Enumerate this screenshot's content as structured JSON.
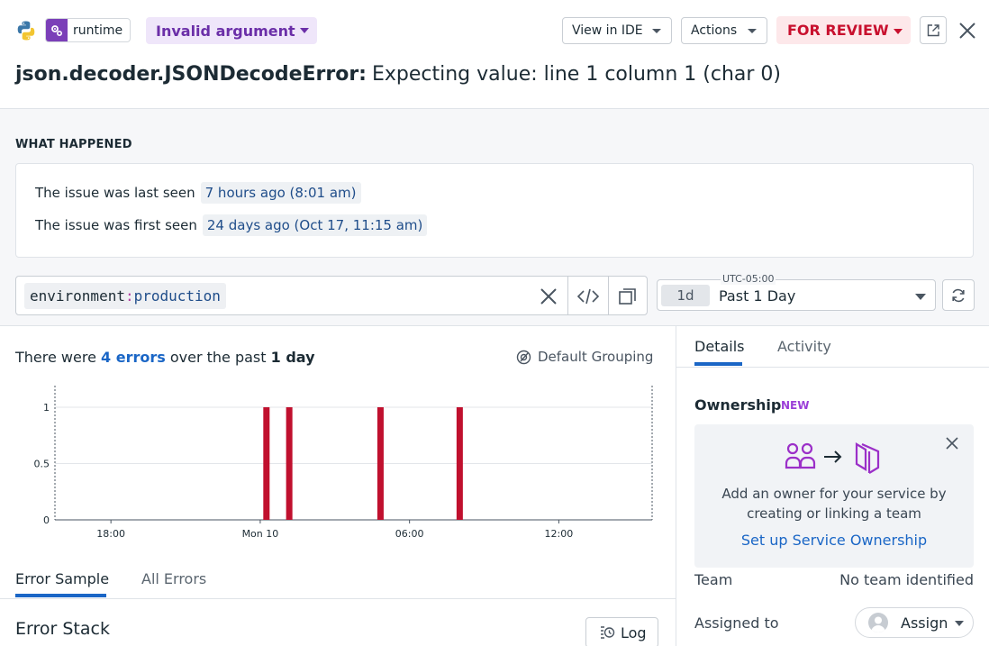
{
  "header": {
    "service_label": "runtime",
    "error_type_label": "Invalid argument",
    "view_in_ide_label": "View in IDE",
    "actions_label": "Actions",
    "status_label": "FOR REVIEW",
    "exception_class": "json.decoder.JSONDecodeError:",
    "exception_message": "Expecting value: line 1 column 1 (char 0)",
    "colors": {
      "status": "#c8102e",
      "type_pill": "#6b2fa8",
      "accent": "#1a66c6"
    }
  },
  "what_happened": {
    "label": "WHAT HAPPENED",
    "last_seen_text": "The issue was last seen",
    "last_seen_value": "7 hours ago (8:01 am)",
    "first_seen_text": "The issue was first seen",
    "first_seen_value": "24 days ago (Oct 17, 11:15 am)"
  },
  "query": {
    "key": "environment",
    "sep": ":",
    "value": "production"
  },
  "time": {
    "timezone": "UTC-05:00",
    "badge": "1d",
    "range_label": "Past 1 Day"
  },
  "summary": {
    "prefix": "There were",
    "count_link": "4 errors",
    "middle": "over the past",
    "period": "1 day",
    "grouping_label": "Default Grouping"
  },
  "chart_data": {
    "type": "bar",
    "x_ticks": [
      "18:00",
      "Mon 10",
      "06:00",
      "12:00"
    ],
    "y_ticks": [
      "0",
      "0.5",
      "1"
    ],
    "ylim": [
      0,
      1
    ],
    "bar_color": "#c0102e",
    "bars": [
      {
        "time": "Mon 10 00:15",
        "value": 1
      },
      {
        "time": "Mon 10 01:10",
        "value": 1
      },
      {
        "time": "Mon 10 04:50",
        "value": 1
      },
      {
        "time": "Mon 10 08:01",
        "value": 1
      }
    ],
    "grid": true
  },
  "left_tabs": {
    "sample": "Error Sample",
    "all": "All Errors"
  },
  "stack": {
    "title": "Error Stack",
    "log_label": "Log"
  },
  "right_tabs": {
    "details": "Details",
    "activity": "Activity"
  },
  "ownership": {
    "title": "Ownership",
    "new_badge": "NEW",
    "text": "Add an owner for your service by creating or linking a team",
    "link": "Set up Service Ownership"
  },
  "details": {
    "team_label": "Team",
    "team_value": "No team identified",
    "assigned_label": "Assigned to",
    "assign_button": "Assign"
  }
}
